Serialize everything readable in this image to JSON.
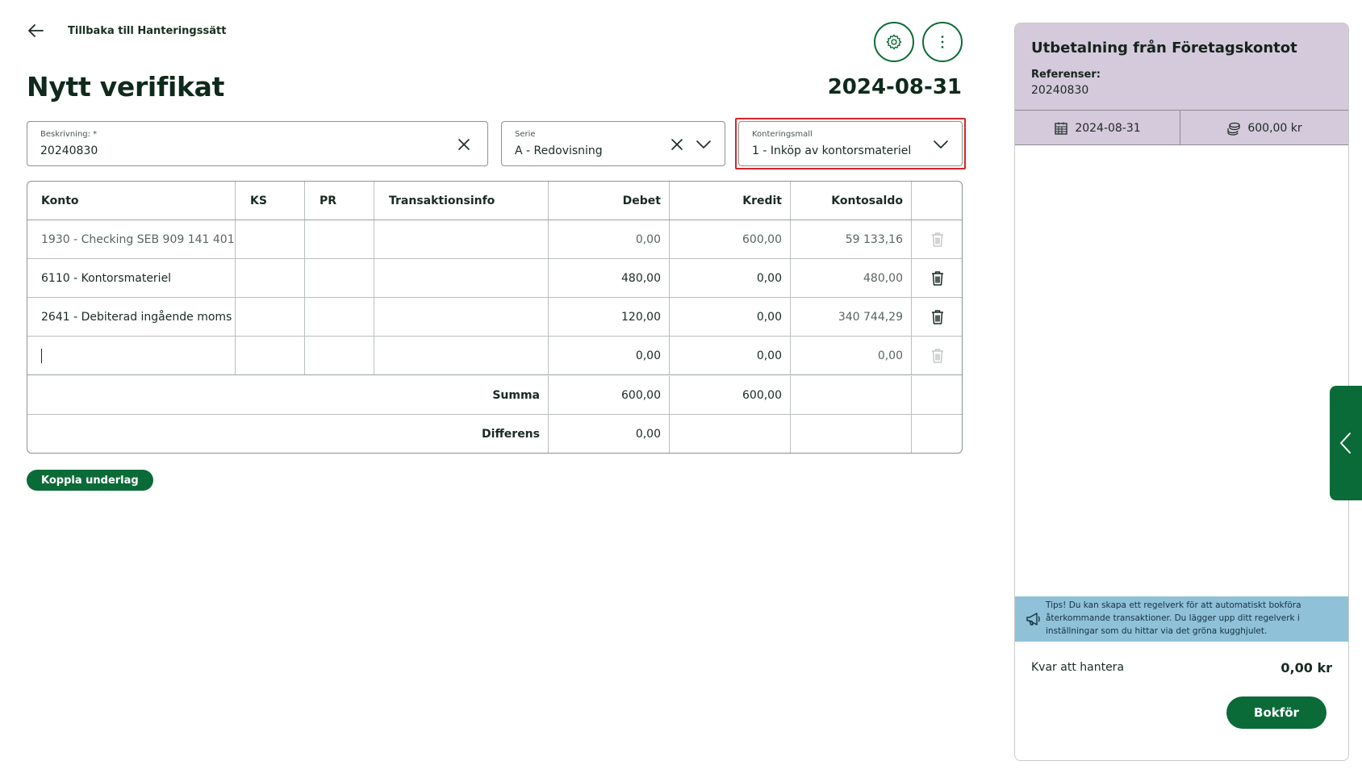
{
  "nav": {
    "back_label": "Tillbaka till Hanteringssätt"
  },
  "header": {
    "title": "Nytt verifikat",
    "date": "2024-08-31"
  },
  "fields": {
    "description": {
      "label": "Beskrivning: *",
      "value": "20240830"
    },
    "serie": {
      "label": "Serie",
      "value": "A - Redovisning"
    },
    "template": {
      "label": "Konteringsmall",
      "value": "1 - Inköp av kontorsmateriel"
    }
  },
  "table": {
    "columns": {
      "konto": "Konto",
      "ks": "KS",
      "pr": "PR",
      "trans": "Transaktionsinfo",
      "debet": "Debet",
      "kredit": "Kredit",
      "saldo": "Kontosaldo"
    },
    "rows": [
      {
        "konto": "1930 - Checking SEB 909 141 401",
        "debet": "0,00",
        "kredit": "600,00",
        "saldo": "59 133,16"
      },
      {
        "konto": "6110 - Kontorsmateriel",
        "debet": "480,00",
        "kredit": "0,00",
        "saldo": "480,00"
      },
      {
        "konto": "2641 - Debiterad ingående moms",
        "debet": "120,00",
        "kredit": "0,00",
        "saldo": "340 744,29"
      },
      {
        "konto": "",
        "debet": "0,00",
        "kredit": "0,00",
        "saldo": "0,00"
      }
    ],
    "summa": {
      "label": "Summa",
      "debet": "600,00",
      "kredit": "600,00"
    },
    "differens": {
      "label": "Differens",
      "debet": "0,00"
    }
  },
  "attach_button": "Koppla underlag",
  "panel": {
    "title": "Utbetalning från Företagskontot",
    "ref_label": "Referenser:",
    "ref_value": "20240830",
    "date": "2024-08-31",
    "amount": "600,00 kr",
    "tips": "Tips! Du kan skapa ett regelverk för att automatiskt bokföra återkommande transaktioner. Du lägger upp ditt regelverk i inställningar som du hittar via det gröna kugghjulet.",
    "remaining_label": "Kvar att hantera",
    "remaining_value": "0,00 kr",
    "book_button": "Bokför"
  },
  "colors": {
    "accent": "#0b6b38",
    "panel_header": "#d5c9dc",
    "tips_bg": "#8fc1d9",
    "highlight": "#d6262b"
  },
  "icons": [
    "arrow-left-icon",
    "gear-icon",
    "more-vertical-icon",
    "close-icon",
    "chevron-down-icon",
    "trash-icon",
    "calendar-icon",
    "coins-icon",
    "megaphone-icon",
    "chevron-left-icon"
  ]
}
